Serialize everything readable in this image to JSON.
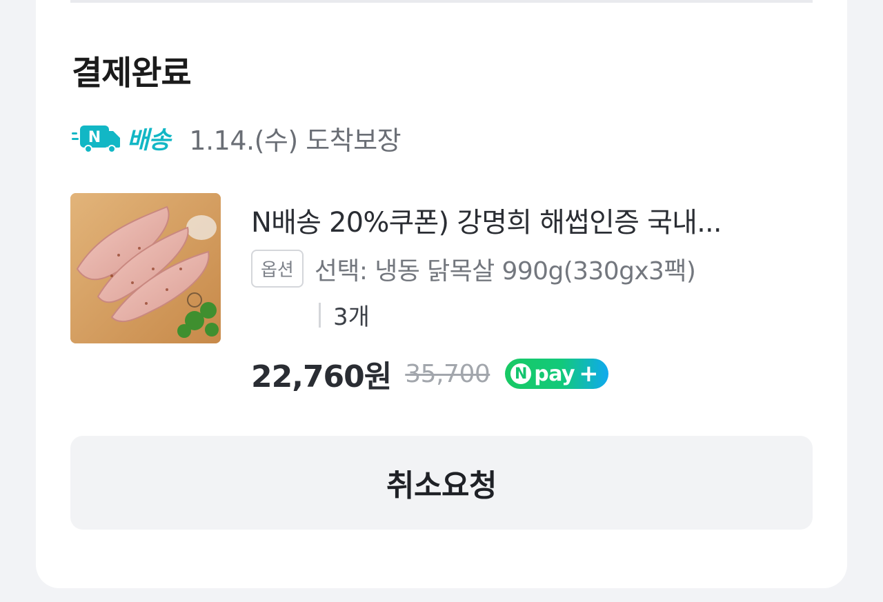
{
  "order": {
    "status_title": "결제완료",
    "delivery": {
      "badge_letter": "N",
      "badge_label": "배송",
      "arrival_text": "1.14.(수) 도착보장"
    },
    "product": {
      "name": "N배송 20%쿠폰) 강명희 해썹인증 국내...",
      "option_tag": "옵션",
      "option_text": "선택: 냉동 닭목살 990g(330gx3팩)",
      "quantity": "3개",
      "price_sale": "22,760원",
      "price_original": "35,700"
    },
    "npay": {
      "n_letter": "N",
      "label": "pay",
      "plus": "+"
    },
    "actions": {
      "cancel_label": "취소요청"
    }
  },
  "colors": {
    "npay_green": "#12c46e",
    "npay_blue": "#10a9ef",
    "delivery_teal": "#12b7c5"
  }
}
